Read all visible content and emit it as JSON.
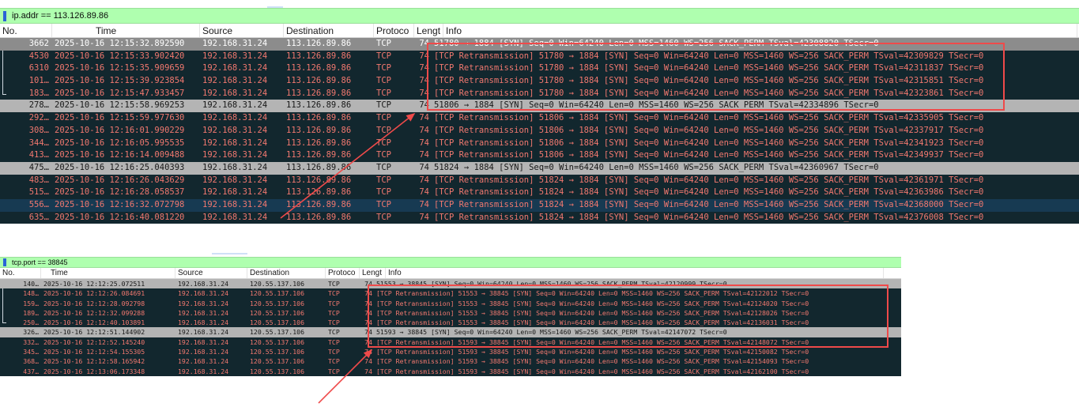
{
  "panes": [
    {
      "filter": "ip.addr == 113.126.89.86",
      "columns": [
        "No.",
        "Time",
        "Source",
        "Destination",
        "Protoco",
        "Lengt",
        "Info"
      ],
      "rows": [
        {
          "no": "3662",
          "time": "2025-10-16 12:15:32.892590",
          "src": "192.168.31.24",
          "dst": "113.126.89.86",
          "proto": "TCP",
          "len": "74",
          "info": "51780 → 1884 [SYN] Seq=0 Win=64240 Len=0 MSS=1460 WS=256 SACK_PERM TSval=42308820 TSecr=0"
        },
        {
          "no": "4530",
          "time": "2025-10-16 12:15:33.902420",
          "src": "192.168.31.24",
          "dst": "113.126.89.86",
          "proto": "TCP",
          "len": "74",
          "info": "[TCP Retransmission] 51780 → 1884 [SYN] Seq=0 Win=64240 Len=0 MSS=1460 WS=256 SACK_PERM TSval=42309829 TSecr=0"
        },
        {
          "no": "6310",
          "time": "2025-10-16 12:15:35.909659",
          "src": "192.168.31.24",
          "dst": "113.126.89.86",
          "proto": "TCP",
          "len": "74",
          "info": "[TCP Retransmission] 51780 → 1884 [SYN] Seq=0 Win=64240 Len=0 MSS=1460 WS=256 SACK_PERM TSval=42311837 TSecr=0"
        },
        {
          "no": "101…",
          "time": "2025-10-16 12:15:39.923854",
          "src": "192.168.31.24",
          "dst": "113.126.89.86",
          "proto": "TCP",
          "len": "74",
          "info": "[TCP Retransmission] 51780 → 1884 [SYN] Seq=0 Win=64240 Len=0 MSS=1460 WS=256 SACK_PERM TSval=42315851 TSecr=0"
        },
        {
          "no": "183…",
          "time": "2025-10-16 12:15:47.933457",
          "src": "192.168.31.24",
          "dst": "113.126.89.86",
          "proto": "TCP",
          "len": "74",
          "info": "[TCP Retransmission] 51780 → 1884 [SYN] Seq=0 Win=64240 Len=0 MSS=1460 WS=256 SACK_PERM TSval=42323861 TSecr=0"
        },
        {
          "no": "278…",
          "time": "2025-10-16 12:15:58.969253",
          "src": "192.168.31.24",
          "dst": "113.126.89.86",
          "proto": "TCP",
          "len": "74",
          "info": "51806 → 1884 [SYN] Seq=0 Win=64240 Len=0 MSS=1460 WS=256 SACK_PERM TSval=42334896 TSecr=0"
        },
        {
          "no": "292…",
          "time": "2025-10-16 12:15:59.977630",
          "src": "192.168.31.24",
          "dst": "113.126.89.86",
          "proto": "TCP",
          "len": "74",
          "info": "[TCP Retransmission] 51806 → 1884 [SYN] Seq=0 Win=64240 Len=0 MSS=1460 WS=256 SACK_PERM TSval=42335905 TSecr=0"
        },
        {
          "no": "308…",
          "time": "2025-10-16 12:16:01.990229",
          "src": "192.168.31.24",
          "dst": "113.126.89.86",
          "proto": "TCP",
          "len": "74",
          "info": "[TCP Retransmission] 51806 → 1884 [SYN] Seq=0 Win=64240 Len=0 MSS=1460 WS=256 SACK_PERM TSval=42337917 TSecr=0"
        },
        {
          "no": "344…",
          "time": "2025-10-16 12:16:05.995535",
          "src": "192.168.31.24",
          "dst": "113.126.89.86",
          "proto": "TCP",
          "len": "74",
          "info": "[TCP Retransmission] 51806 → 1884 [SYN] Seq=0 Win=64240 Len=0 MSS=1460 WS=256 SACK_PERM TSval=42341923 TSecr=0"
        },
        {
          "no": "413…",
          "time": "2025-10-16 12:16:14.009488",
          "src": "192.168.31.24",
          "dst": "113.126.89.86",
          "proto": "TCP",
          "len": "74",
          "info": "[TCP Retransmission] 51806 → 1884 [SYN] Seq=0 Win=64240 Len=0 MSS=1460 WS=256 SACK_PERM TSval=42349937 TSecr=0"
        },
        {
          "no": "475…",
          "time": "2025-10-16 12:16:25.040393",
          "src": "192.168.31.24",
          "dst": "113.126.89.86",
          "proto": "TCP",
          "len": "74",
          "info": "51824 → 1884 [SYN] Seq=0 Win=64240 Len=0 MSS=1460 WS=256 SACK_PERM TSval=42360967 TSecr=0"
        },
        {
          "no": "483…",
          "time": "2025-10-16 12:16:26.043629",
          "src": "192.168.31.24",
          "dst": "113.126.89.86",
          "proto": "TCP",
          "len": "74",
          "info": "[TCP Retransmission] 51824 → 1884 [SYN] Seq=0 Win=64240 Len=0 MSS=1460 WS=256 SACK_PERM TSval=42361971 TSecr=0"
        },
        {
          "no": "515…",
          "time": "2025-10-16 12:16:28.058537",
          "src": "192.168.31.24",
          "dst": "113.126.89.86",
          "proto": "TCP",
          "len": "74",
          "info": "[TCP Retransmission] 51824 → 1884 [SYN] Seq=0 Win=64240 Len=0 MSS=1460 WS=256 SACK_PERM TSval=42363986 TSecr=0"
        },
        {
          "no": "556…",
          "time": "2025-10-16 12:16:32.072798",
          "src": "192.168.31.24",
          "dst": "113.126.89.86",
          "proto": "TCP",
          "len": "74",
          "info": "[TCP Retransmission] 51824 → 1884 [SYN] Seq=0 Win=64240 Len=0 MSS=1460 WS=256 SACK_PERM TSval=42368000 TSecr=0"
        },
        {
          "no": "635…",
          "time": "2025-10-16 12:16:40.081220",
          "src": "192.168.31.24",
          "dst": "113.126.89.86",
          "proto": "TCP",
          "len": "74",
          "info": "[TCP Retransmission] 51824 → 1884 [SYN] Seq=0 Win=64240 Len=0 MSS=1460 WS=256 SACK_PERM TSval=42376008 TSecr=0"
        }
      ]
    },
    {
      "filter": "tcp.port == 38845",
      "columns": [
        "No.",
        "Time",
        "Source",
        "Destination",
        "Protoco",
        "Lengt",
        "Info"
      ],
      "rows": [
        {
          "no": "140…",
          "time": "2025-10-16 12:12:25.072511",
          "src": "192.168.31.24",
          "dst": "120.55.137.106",
          "proto": "TCP",
          "len": "74",
          "info": "51553 → 38845 [SYN] Seq=0 Win=64240 Len=0 MSS=1460 WS=256 SACK_PERM TSval=42120999 TSecr=0"
        },
        {
          "no": "148…",
          "time": "2025-10-16 12:12:26.084691",
          "src": "192.168.31.24",
          "dst": "120.55.137.106",
          "proto": "TCP",
          "len": "74",
          "info": "[TCP Retransmission] 51553 → 38845 [SYN] Seq=0 Win=64240 Len=0 MSS=1460 WS=256 SACK_PERM TSval=42122012 TSecr=0"
        },
        {
          "no": "159…",
          "time": "2025-10-16 12:12:28.092798",
          "src": "192.168.31.24",
          "dst": "120.55.137.106",
          "proto": "TCP",
          "len": "74",
          "info": "[TCP Retransmission] 51553 → 38845 [SYN] Seq=0 Win=64240 Len=0 MSS=1460 WS=256 SACK_PERM TSval=42124020 TSecr=0"
        },
        {
          "no": "189…",
          "time": "2025-10-16 12:12:32.099288",
          "src": "192.168.31.24",
          "dst": "120.55.137.106",
          "proto": "TCP",
          "len": "74",
          "info": "[TCP Retransmission] 51553 → 38845 [SYN] Seq=0 Win=64240 Len=0 MSS=1460 WS=256 SACK_PERM TSval=42128026 TSecr=0"
        },
        {
          "no": "250…",
          "time": "2025-10-16 12:12:40.103891",
          "src": "192.168.31.24",
          "dst": "120.55.137.106",
          "proto": "TCP",
          "len": "74",
          "info": "[TCP Retransmission] 51553 → 38845 [SYN] Seq=0 Win=64240 Len=0 MSS=1460 WS=256 SACK_PERM TSval=42136031 TSecr=0"
        },
        {
          "no": "326…",
          "time": "2025-10-16 12:12:51.144902",
          "src": "192.168.31.24",
          "dst": "120.55.137.106",
          "proto": "TCP",
          "len": "74",
          "info": "51593 → 38845 [SYN] Seq=0 Win=64240 Len=0 MSS=1460 WS=256 SACK_PERM TSval=42147072 TSecr=0"
        },
        {
          "no": "332…",
          "time": "2025-10-16 12:12:52.145240",
          "src": "192.168.31.24",
          "dst": "120.55.137.106",
          "proto": "TCP",
          "len": "74",
          "info": "[TCP Retransmission] 51593 → 38845 [SYN] Seq=0 Win=64240 Len=0 MSS=1460 WS=256 SACK_PERM TSval=42148072 TSecr=0"
        },
        {
          "no": "345…",
          "time": "2025-10-16 12:12:54.155305",
          "src": "192.168.31.24",
          "dst": "120.55.137.106",
          "proto": "TCP",
          "len": "74",
          "info": "[TCP Retransmission] 51593 → 38845 [SYN] Seq=0 Win=64240 Len=0 MSS=1460 WS=256 SACK_PERM TSval=42150082 TSecr=0"
        },
        {
          "no": "368…",
          "time": "2025-10-16 12:12:58.165942",
          "src": "192.168.31.24",
          "dst": "120.55.137.106",
          "proto": "TCP",
          "len": "74",
          "info": "[TCP Retransmission] 51593 → 38845 [SYN] Seq=0 Win=64240 Len=0 MSS=1460 WS=256 SACK_PERM TSval=42154093 TSecr=0"
        },
        {
          "no": "437…",
          "time": "2025-10-16 12:13:06.173348",
          "src": "192.168.31.24",
          "dst": "120.55.137.106",
          "proto": "TCP",
          "len": "74",
          "info": "[TCP Retransmission] 51593 → 38845 [SYN] Seq=0 Win=64240 Len=0 MSS=1460 WS=256 SACK_PERM TSval=42162100 TSecr=0"
        }
      ]
    }
  ],
  "colors": {
    "filter_bg": "#afffaf",
    "selected_row": "#8c8c8c",
    "syn_row": "#b4b4b4",
    "retransmission_row": "#12272e",
    "retransmission_text": "#f1786f",
    "annotation_red": "#ef4a4a"
  }
}
